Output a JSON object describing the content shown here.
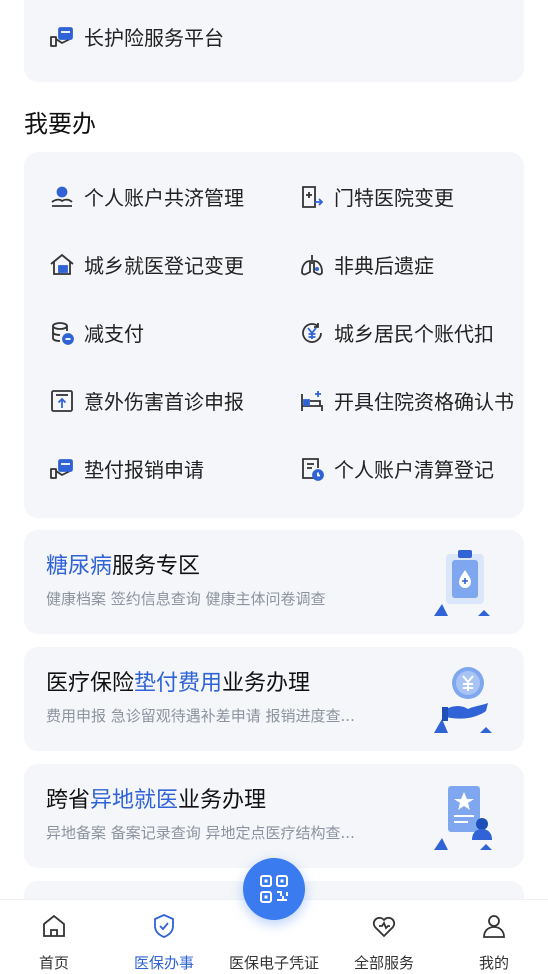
{
  "top_item": {
    "label": "长护险服务平台",
    "icon": "hand-card-icon"
  },
  "section_title": "我要办",
  "grid": [
    {
      "label": "个人账户共济管理",
      "icon": "shared-account-icon"
    },
    {
      "label": "门特医院变更",
      "icon": "hospital-change-icon"
    },
    {
      "label": "城乡就医登记变更",
      "icon": "home-register-icon"
    },
    {
      "label": "非典后遗症",
      "icon": "lungs-icon"
    },
    {
      "label": "减支付",
      "icon": "database-minus-icon"
    },
    {
      "label": "城乡居民个账代扣",
      "icon": "yuan-refresh-icon"
    },
    {
      "label": "意外伤害首诊申报",
      "icon": "upload-doc-icon"
    },
    {
      "label": "开具住院资格确认书",
      "icon": "hospital-bed-icon"
    },
    {
      "label": "垫付报销申请",
      "icon": "hand-card-icon"
    },
    {
      "label": "个人账户清算登记",
      "icon": "doc-clock-icon"
    }
  ],
  "services": [
    {
      "title_highlight": "糖尿病",
      "title_prefix": "",
      "title_suffix": "服务专区",
      "subtitle": "健康档案 签约信息查询 健康主体问卷调查",
      "art": "medical-board-illustration"
    },
    {
      "title_prefix": "医疗保险",
      "title_highlight": "垫付费用",
      "title_suffix": "业务办理",
      "subtitle": "费用申报 急诊留观待遇补差申请 报销进度查...",
      "art": "coin-hand-illustration"
    },
    {
      "title_prefix": "跨省",
      "title_highlight": "异地就医",
      "title_suffix": "业务办理",
      "subtitle": "异地备案 备案记录查询 异地定点医疗结构查...",
      "art": "doc-person-illustration"
    }
  ],
  "nav": [
    {
      "label": "首页",
      "icon": "home-icon"
    },
    {
      "label": "医保办事",
      "icon": "shield-check-icon",
      "active": true
    },
    {
      "label": "医保电子凭证",
      "icon": "qr-code-icon"
    },
    {
      "label": "全部服务",
      "icon": "heart-icon"
    },
    {
      "label": "我的",
      "icon": "user-icon"
    }
  ],
  "colors": {
    "accent": "#2f63d6",
    "card_bg": "#f4f6f9",
    "fab": "#3a7bf0"
  }
}
